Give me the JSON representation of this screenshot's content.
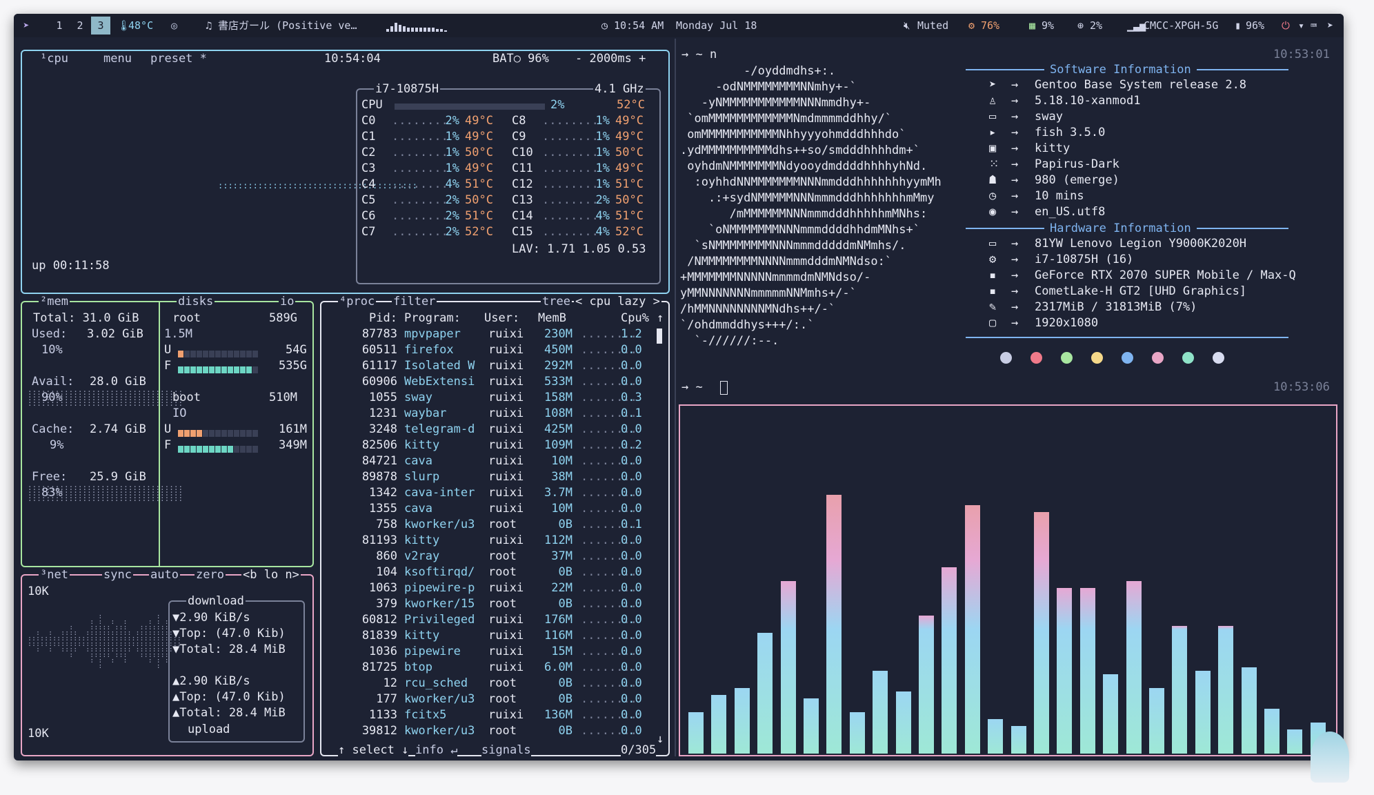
{
  "topbar": {
    "launcher_icon": "gentoo-icon",
    "workspaces": [
      "1",
      "2",
      "3"
    ],
    "active_workspace": "3",
    "temp": "48°C",
    "media": "♫ 書店ガール (Positive ve…",
    "clock": "10:54 AM",
    "date": "Monday Jul 18",
    "volume": "Muted",
    "cpu": "76%",
    "mem": "9%",
    "disk": "2%",
    "wifi": "CMCC-XPGH-5G",
    "battery": "96%"
  },
  "btop": {
    "cpu_header": {
      "tag": "¹cpu",
      "menu": "menu",
      "preset": "preset *",
      "time": "10:54:04",
      "bat": "BAT○ 96%",
      "interval": "- 2000ms +"
    },
    "cpu_model": "i7-10875H",
    "cpu_freq": "4.1 GHz",
    "cpu_total": {
      "label": "CPU",
      "pct": "2%",
      "temp": "52°C"
    },
    "cores_left": [
      {
        "n": "C0",
        "pct": "2%",
        "temp": "49°C"
      },
      {
        "n": "C1",
        "pct": "1%",
        "temp": "49°C"
      },
      {
        "n": "C2",
        "pct": "1%",
        "temp": "50°C"
      },
      {
        "n": "C3",
        "pct": "1%",
        "temp": "49°C"
      },
      {
        "n": "C4",
        "pct": "4%",
        "temp": "51°C"
      },
      {
        "n": "C5",
        "pct": "2%",
        "temp": "50°C"
      },
      {
        "n": "C6",
        "pct": "2%",
        "temp": "51°C"
      },
      {
        "n": "C7",
        "pct": "2%",
        "temp": "52°C"
      }
    ],
    "cores_right": [
      {
        "n": "C8",
        "pct": "1%",
        "temp": "49°C"
      },
      {
        "n": "C9",
        "pct": "1%",
        "temp": "49°C"
      },
      {
        "n": "C10",
        "pct": "1%",
        "temp": "50°C"
      },
      {
        "n": "C11",
        "pct": "1%",
        "temp": "49°C"
      },
      {
        "n": "C12",
        "pct": "1%",
        "temp": "51°C"
      },
      {
        "n": "C13",
        "pct": "2%",
        "temp": "50°C"
      },
      {
        "n": "C14",
        "pct": "4%",
        "temp": "51°C"
      },
      {
        "n": "C15",
        "pct": "4%",
        "temp": "52°C"
      }
    ],
    "lav": "LAV: 1.71 1.05 0.53",
    "uptime": "up 00:11:58",
    "mem": {
      "tag": "²mem",
      "total": "Total: 31.0 GiB",
      "used": "Used:",
      "used_val": "3.02 GiB",
      "used_pct": "10%",
      "avail": "Avail:",
      "avail_val": "28.0 GiB",
      "avail_pct": "90%",
      "cache": "Cache:",
      "cache_val": "2.74 GiB",
      "cache_pct": "9%",
      "free": "Free:",
      "free_val": "25.9 GiB",
      "free_pct": "83%"
    },
    "disks": {
      "tag": "disks",
      "io": "io",
      "root_name": "root",
      "root_size": "589G",
      "root_io": "1.5M",
      "root_u": "54G",
      "root_f": "535G",
      "boot_name": "boot",
      "boot_size": "510M",
      "boot_io": "IO",
      "boot_u": "161M",
      "boot_f": "349M"
    },
    "net": {
      "tag": "³net",
      "sync": "sync",
      "auto": "auto",
      "zero": "zero",
      "iface": "<b lo n>",
      "scale_top": "10K",
      "scale_bot": "10K",
      "down_title": "download",
      "down_rate": "▼2.90 KiB/s",
      "down_top": "▼Top: (47.0 Kib)",
      "down_total": "▼Total: 28.4 MiB",
      "up_rate": "▲2.90 KiB/s",
      "up_top": "▲Top: (47.0 Kib)",
      "up_total": "▲Total: 28.4 MiB",
      "up_title": "upload"
    },
    "proc": {
      "tag": "⁴proc",
      "filter": "filter",
      "tree": "tree",
      "sort": "< cpu lazy >",
      "headers": {
        "pid": "Pid:",
        "prog": "Program:",
        "user": "User:",
        "mem": "MemB",
        "cpu": "Cpu%"
      },
      "rows": [
        [
          "87783",
          "mpvpaper",
          "ruixi",
          "230M",
          "1.2"
        ],
        [
          "60511",
          "firefox",
          "ruixi",
          "450M",
          "0.0"
        ],
        [
          "61117",
          "Isolated W",
          "ruixi",
          "292M",
          "0.0"
        ],
        [
          "60906",
          "WebExtensi",
          "ruixi",
          "533M",
          "0.0"
        ],
        [
          "1055",
          "sway",
          "ruixi",
          "158M",
          "0.3"
        ],
        [
          "1231",
          "waybar",
          "ruixi",
          "108M",
          "0.1"
        ],
        [
          "3248",
          "telegram-d",
          "ruixi",
          "425M",
          "0.0"
        ],
        [
          "82506",
          "kitty",
          "ruixi",
          "109M",
          "0.2"
        ],
        [
          "84721",
          "cava",
          "ruixi",
          "10M",
          "0.0"
        ],
        [
          "89878",
          "slurp",
          "ruixi",
          "38M",
          "0.0"
        ],
        [
          "1342",
          "cava-inter",
          "ruixi",
          "3.7M",
          "0.0"
        ],
        [
          "1355",
          "cava",
          "ruixi",
          "10M",
          "0.0"
        ],
        [
          "758",
          "kworker/u3",
          "root",
          "0B",
          "0.1"
        ],
        [
          "81193",
          "kitty",
          "ruixi",
          "112M",
          "0.0"
        ],
        [
          "860",
          "v2ray",
          "root",
          "37M",
          "0.0"
        ],
        [
          "104",
          "ksoftirqd/",
          "root",
          "0B",
          "0.0"
        ],
        [
          "1063",
          "pipewire-p",
          "ruixi",
          "22M",
          "0.0"
        ],
        [
          "379",
          "kworker/15",
          "root",
          "0B",
          "0.0"
        ],
        [
          "60812",
          "Privileged",
          "ruixi",
          "176M",
          "0.0"
        ],
        [
          "81839",
          "kitty",
          "ruixi",
          "116M",
          "0.0"
        ],
        [
          "1036",
          "pipewire",
          "ruixi",
          "15M",
          "0.0"
        ],
        [
          "81725",
          "btop",
          "ruixi",
          "6.0M",
          "0.0"
        ],
        [
          "12",
          "rcu_sched",
          "root",
          "0B",
          "0.0"
        ],
        [
          "177",
          "kworker/u3",
          "root",
          "0B",
          "0.0"
        ],
        [
          "1133",
          "fcitx5",
          "ruixi",
          "136M",
          "0.0"
        ],
        [
          "39812",
          "kworker/u3",
          "root",
          "0B",
          "0.0"
        ]
      ],
      "footer_select": "↑ select ↓",
      "footer_info": "info ↵",
      "footer_signals": "signals",
      "count": "0/305"
    }
  },
  "terminal": {
    "prompt": "→ ~ n",
    "time1": "10:53:01",
    "time2": "10:53:06",
    "prompt2": "→ ~",
    "logo": [
      "         -/oyddmdhs+:.",
      "     -odNMMMMMMMMNNmhy+-`",
      "   -yNMMMMMMMMMMMNNNmmdhy+-",
      " `omMMMMMMMMMMMMNmdmmmmddhhy/`",
      " omMMMMMMMMMMMNhhyyyohmdddhhhdo`",
      ".ydMMMMMMMMMMdhs++so/smdddhhhhdm+`",
      " oyhdmNMMMMMMMNdyooydmddddhhhhyhNd.",
      "  :oyhhdNNMMMMMMMNNNmmdddhhhhhhhyymMh",
      "    .:+sydNMMMMMNNNmmmdddhhhhhhhmMmy",
      "       /mMMMMMMNNNmmmdddhhhhhmMNhs:",
      "    `oNMMMMMMMNNNmmmddddhhdmMNhs+`",
      "  `sNMMMMMMMMNNNmmmdddddmNMmhs/.",
      " /NMMMMMMMMNNNNmmmdddmNMNdso:`",
      "+MMMMMMMNNNNNmmmmdmNMNdso/-",
      "yMMNNNNNNNmmmmmNNMmhs+/-`",
      "/hMMNNNNNNNNMNdhs++/-`",
      "`/ohdmmddhys+++/:.`",
      "  `-//////:--."
    ],
    "sw_title": "Software Information",
    "hw_title": "Hardware Information",
    "sw": [
      {
        "icon": "gentoo-icon",
        "v": "Gentoo Base System release 2.8"
      },
      {
        "icon": "kernel-icon",
        "v": "5.18.10-xanmod1"
      },
      {
        "icon": "window-icon",
        "v": "sway"
      },
      {
        "icon": "shell-icon",
        "v": "fish 3.5.0"
      },
      {
        "icon": "terminal-icon",
        "v": "kitty"
      },
      {
        "icon": "theme-icon",
        "v": "Papirus-Dark"
      },
      {
        "icon": "package-icon",
        "v": "980 (emerge)"
      },
      {
        "icon": "clock-icon",
        "v": "10 mins"
      },
      {
        "icon": "location-icon",
        "v": "en_US.utf8"
      }
    ],
    "hw": [
      {
        "icon": "laptop-icon",
        "v": "81YW Lenovo Legion Y9000K2020H"
      },
      {
        "icon": "cpu-icon",
        "v": "i7-10875H (16)"
      },
      {
        "icon": "gpu-icon",
        "v": "GeForce RTX 2070 SUPER Mobile / Max-Q"
      },
      {
        "icon": "gpu-icon",
        "v": "CometLake-H GT2 [UHD Graphics]"
      },
      {
        "icon": "memory-icon",
        "v": "2317MiB / 31813MiB (7%)"
      },
      {
        "icon": "monitor-icon",
        "v": "1920x1080"
      }
    ],
    "palette": [
      "#c8cde4",
      "#f07a8a",
      "#a8e6a0",
      "#f6d98a",
      "#7fb4f0",
      "#e9a6c6",
      "#8fe3c8",
      "#d8dcf0"
    ]
  },
  "cava": {
    "levels": [
      0.12,
      0.17,
      0.19,
      0.35,
      0.5,
      0.16,
      0.75,
      0.12,
      0.24,
      0.18,
      0.4,
      0.54,
      0.72,
      0.1,
      0.08,
      0.7,
      0.48,
      0.48,
      0.23,
      0.5,
      0.19,
      0.37,
      0.24,
      0.37,
      0.25,
      0.13,
      0.07,
      0.09
    ],
    "colors": [
      "#9ee8d6",
      "#9cd6f2",
      "#e6a8d4",
      "#e8a0ac"
    ]
  }
}
